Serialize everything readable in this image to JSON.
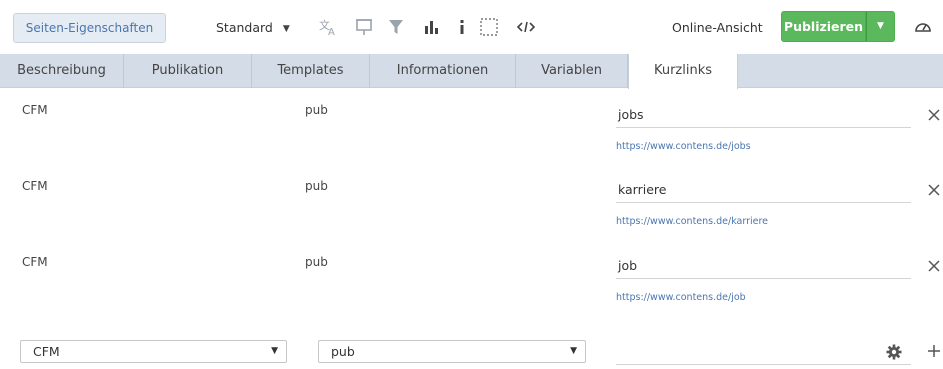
{
  "toolbar": {
    "page_properties_label": "Seiten-Eigenschaften",
    "view_select_value": "Standard",
    "online_view_label": "Online-Ansicht",
    "publish_label": "Publizieren",
    "icons": [
      "translate-icon",
      "presentation-icon",
      "filter-icon",
      "bar-chart-icon",
      "info-icon",
      "selection-icon",
      "code-icon",
      "speedometer-icon"
    ]
  },
  "tabs": [
    {
      "label": "Beschreibung",
      "active": false
    },
    {
      "label": "Publikation",
      "active": false
    },
    {
      "label": "Templates",
      "active": false
    },
    {
      "label": "Informationen",
      "active": false
    },
    {
      "label": "Variablen",
      "active": false
    },
    {
      "label": "Kurzlinks",
      "active": true
    }
  ],
  "shortlinks": [
    {
      "project": "CFM",
      "publication": "pub",
      "alias": "jobs",
      "url": "https://www.contens.de/jobs"
    },
    {
      "project": "CFM",
      "publication": "pub",
      "alias": "karriere",
      "url": "https://www.contens.de/karriere"
    },
    {
      "project": "CFM",
      "publication": "pub",
      "alias": "job",
      "url": "https://www.contens.de/job"
    }
  ],
  "new_entry": {
    "project_value": "CFM",
    "publication_value": "pub",
    "alias_value": ""
  },
  "colors": {
    "accent": "#4a76b1",
    "publish_green": "#5cb85c",
    "tab_bar": "#d4dce7"
  }
}
